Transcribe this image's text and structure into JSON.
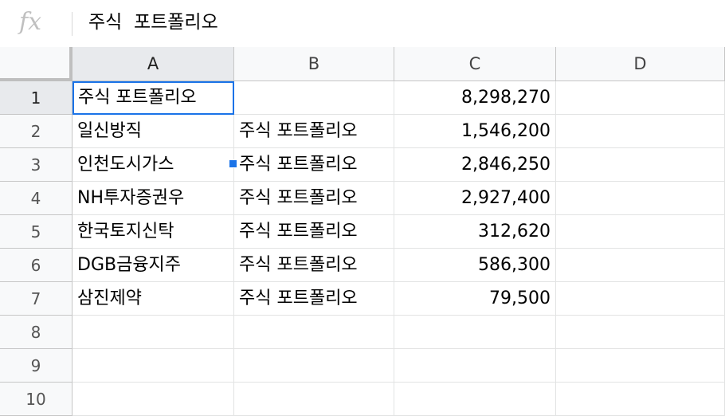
{
  "formula_bar": {
    "fx_label": "fx",
    "value": "주식  포트폴리오"
  },
  "columns": [
    "A",
    "B",
    "C",
    "D"
  ],
  "rows": [
    {
      "num": "1",
      "a": "주식 포트폴리오",
      "b": "",
      "c": "8,298,270",
      "d": ""
    },
    {
      "num": "2",
      "a": "일신방직",
      "b": "주식 포트폴리오",
      "c": "1,546,200",
      "d": ""
    },
    {
      "num": "3",
      "a": "인천도시가스",
      "b": "주식 포트폴리오",
      "c": "2,846,250",
      "d": ""
    },
    {
      "num": "4",
      "a": "NH투자증권우",
      "b": "주식 포트폴리오",
      "c": "2,927,400",
      "d": ""
    },
    {
      "num": "5",
      "a": "한국토지신탁",
      "b": "주식 포트폴리오",
      "c": "312,620",
      "d": ""
    },
    {
      "num": "6",
      "a": "DGB금융지주",
      "b": "주식 포트폴리오",
      "c": "586,300",
      "d": ""
    },
    {
      "num": "7",
      "a": "삼진제약",
      "b": "주식 포트폴리오",
      "c": "79,500",
      "d": ""
    },
    {
      "num": "8",
      "a": "",
      "b": "",
      "c": "",
      "d": ""
    },
    {
      "num": "9",
      "a": "",
      "b": "",
      "c": "",
      "d": ""
    },
    {
      "num": "10",
      "a": "",
      "b": "",
      "c": "",
      "d": ""
    }
  ],
  "selection": {
    "cell": "A1",
    "color": "#1a73e8"
  }
}
